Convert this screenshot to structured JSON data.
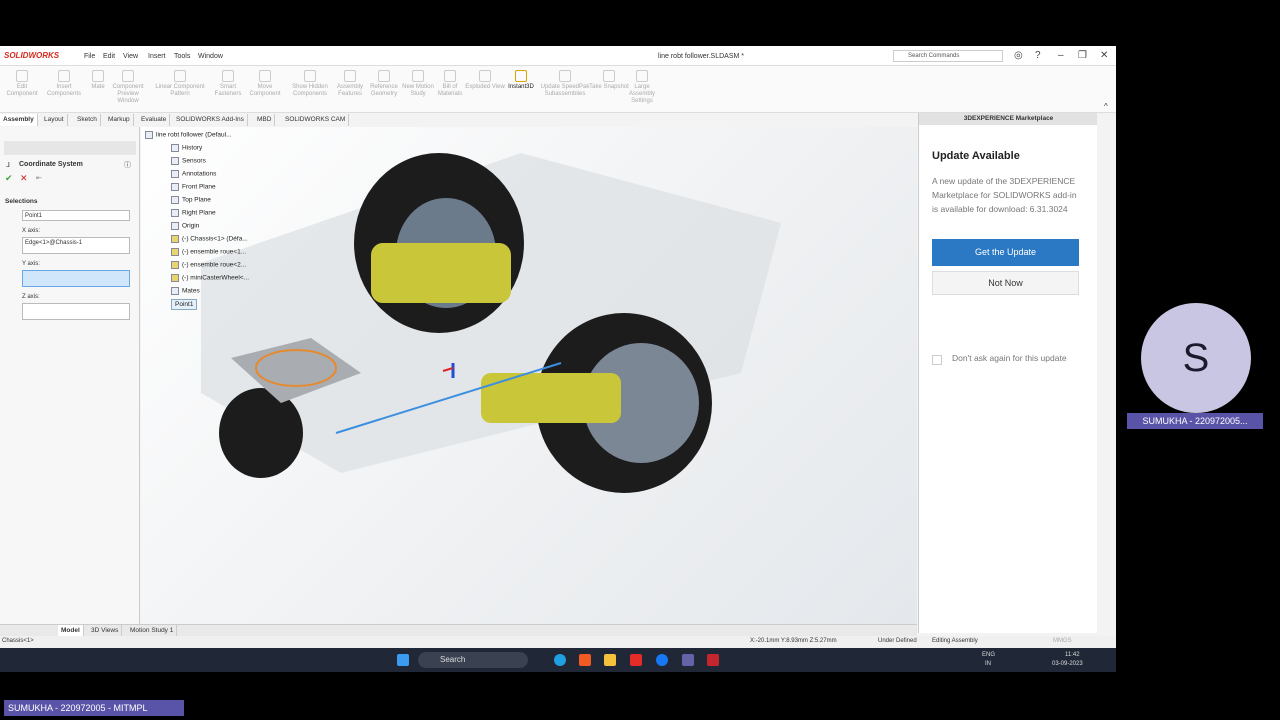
{
  "app": {
    "brand": "SOLIDWORKS",
    "document_title": "line robt follower.SLDASM *",
    "menus": [
      "File",
      "Edit",
      "View",
      "Insert",
      "Tools",
      "Window"
    ],
    "search_placeholder": "Search Commands"
  },
  "ribbon": [
    "Edit Component",
    "Insert Components",
    "Mate",
    "Component Preview Window",
    "Linear Component Pattern",
    "Smart Fasteners",
    "Move Component",
    "Show Hidden Components",
    "Assembly Features",
    "Reference Geometry",
    "New Motion Study",
    "Bill of Materials",
    "Exploded View",
    "Instant3D",
    "Update SpeedPak Subassemblies",
    "Take Snapshot",
    "Large Assembly Settings"
  ],
  "tabs": [
    "Assembly",
    "Layout",
    "Sketch",
    "Markup",
    "Evaluate",
    "SOLIDWORKS Add-Ins",
    "MBD",
    "SOLIDWORKS CAM"
  ],
  "property": {
    "title": "Coordinate System",
    "section": "Selections",
    "origin_value": "Point1",
    "x_label": "X axis:",
    "x_value": "Edge<1>@Chassis-1",
    "y_label": "Y axis:",
    "y_value": "",
    "z_label": "Z axis:",
    "z_value": ""
  },
  "tree": [
    "line robt follower  (Defaul...",
    "History",
    "Sensors",
    "Annotations",
    "Front Plane",
    "Top Plane",
    "Right Plane",
    "Origin",
    "(-) Chassis<1> (Défa...",
    "(-) ensemble roue<1...",
    "(-) ensemble roue<2...",
    "(-) miniCasterWheel<...",
    "Mates",
    "Point1"
  ],
  "marketplace": {
    "header": "3DEXPERIENCE Marketplace",
    "title": "Update Available",
    "body": "A new update of the 3DEXPERIENCE Marketplace for SOLIDWORKS add-in is available for download: 6.31.3024",
    "primary": "Get the Update",
    "secondary": "Not Now",
    "checkbox": "Don't ask again for this update"
  },
  "bottom_tabs": [
    "Model",
    "3D Views",
    "Motion Study 1"
  ],
  "status": {
    "left": "Chassis<1>",
    "coords": "X:-20.1mm Y:8.93mm Z:5.27mm",
    "state": "Under Defined",
    "mode": "Editing Assembly",
    "units": "MMGS"
  },
  "taskbar": {
    "search": "Search",
    "lang": "ENG",
    "region": "IN",
    "time": "11:42",
    "date": "03-09-2023"
  },
  "meeting": {
    "initial": "S",
    "participant": "SUMUKHA - 220972005...",
    "self": "SUMUKHA - 220972005 - MITMPL"
  }
}
